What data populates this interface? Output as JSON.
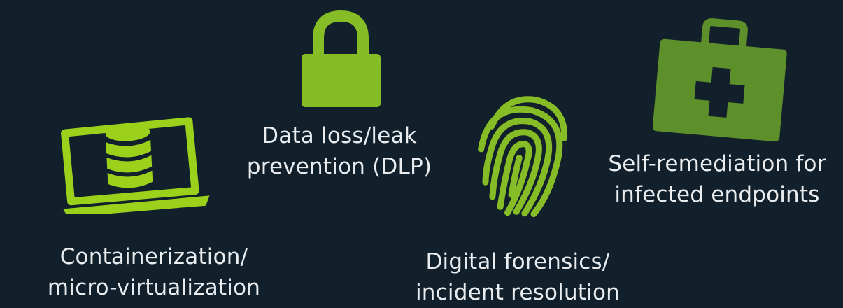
{
  "colors": {
    "background": "#11202b",
    "text": "#e9edf0",
    "bright_green": "#9bd11b",
    "mid_green": "#86bc25",
    "dark_green": "#5d8f2a"
  },
  "features": [
    {
      "icon": "laptop-database-icon",
      "line1": "Containerization/",
      "line2": "micro-virtualization"
    },
    {
      "icon": "lock-icon",
      "line1": "Data loss/leak",
      "line2": "prevention (DLP)"
    },
    {
      "icon": "fingerprint-icon",
      "line1": "Digital forensics/",
      "line2": "incident resolution"
    },
    {
      "icon": "first-aid-kit-icon",
      "line1": "Self-remediation for",
      "line2": "infected endpoints"
    }
  ]
}
